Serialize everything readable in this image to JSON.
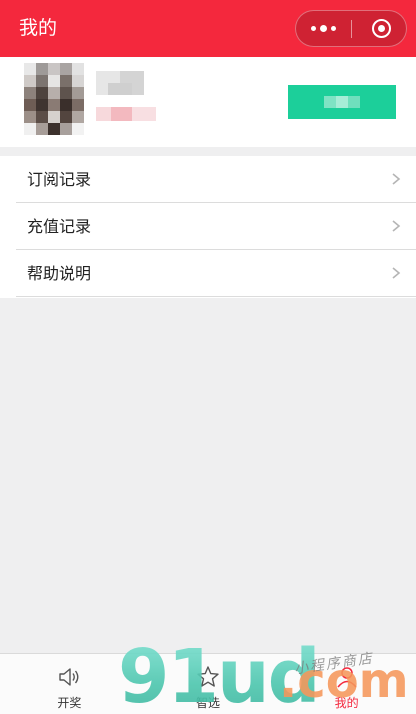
{
  "nav": {
    "title": "我的",
    "more_icon": "more-dots-icon",
    "close_icon": "target-circle-icon",
    "background": "#f4283d"
  },
  "profile": {
    "avatar": "blurred-avatar",
    "accent": "#1ccf9a"
  },
  "menu": {
    "items": [
      {
        "label": "订阅记录",
        "icon": "chevron-right-icon"
      },
      {
        "label": "充值记录",
        "icon": "chevron-right-icon"
      },
      {
        "label": "帮助说明",
        "icon": "chevron-right-icon"
      }
    ]
  },
  "tabbar": {
    "items": [
      {
        "label": "开奖",
        "icon": "speaker-icon",
        "active": false
      },
      {
        "label": "智选",
        "icon": "star-outline-icon",
        "active": false
      },
      {
        "label": "我的",
        "icon": "user-icon",
        "active": true
      }
    ],
    "active_color": "#f4283d"
  },
  "watermark": {
    "main": "91ud",
    "suffix": ".com",
    "tagline": "小程序商店"
  }
}
